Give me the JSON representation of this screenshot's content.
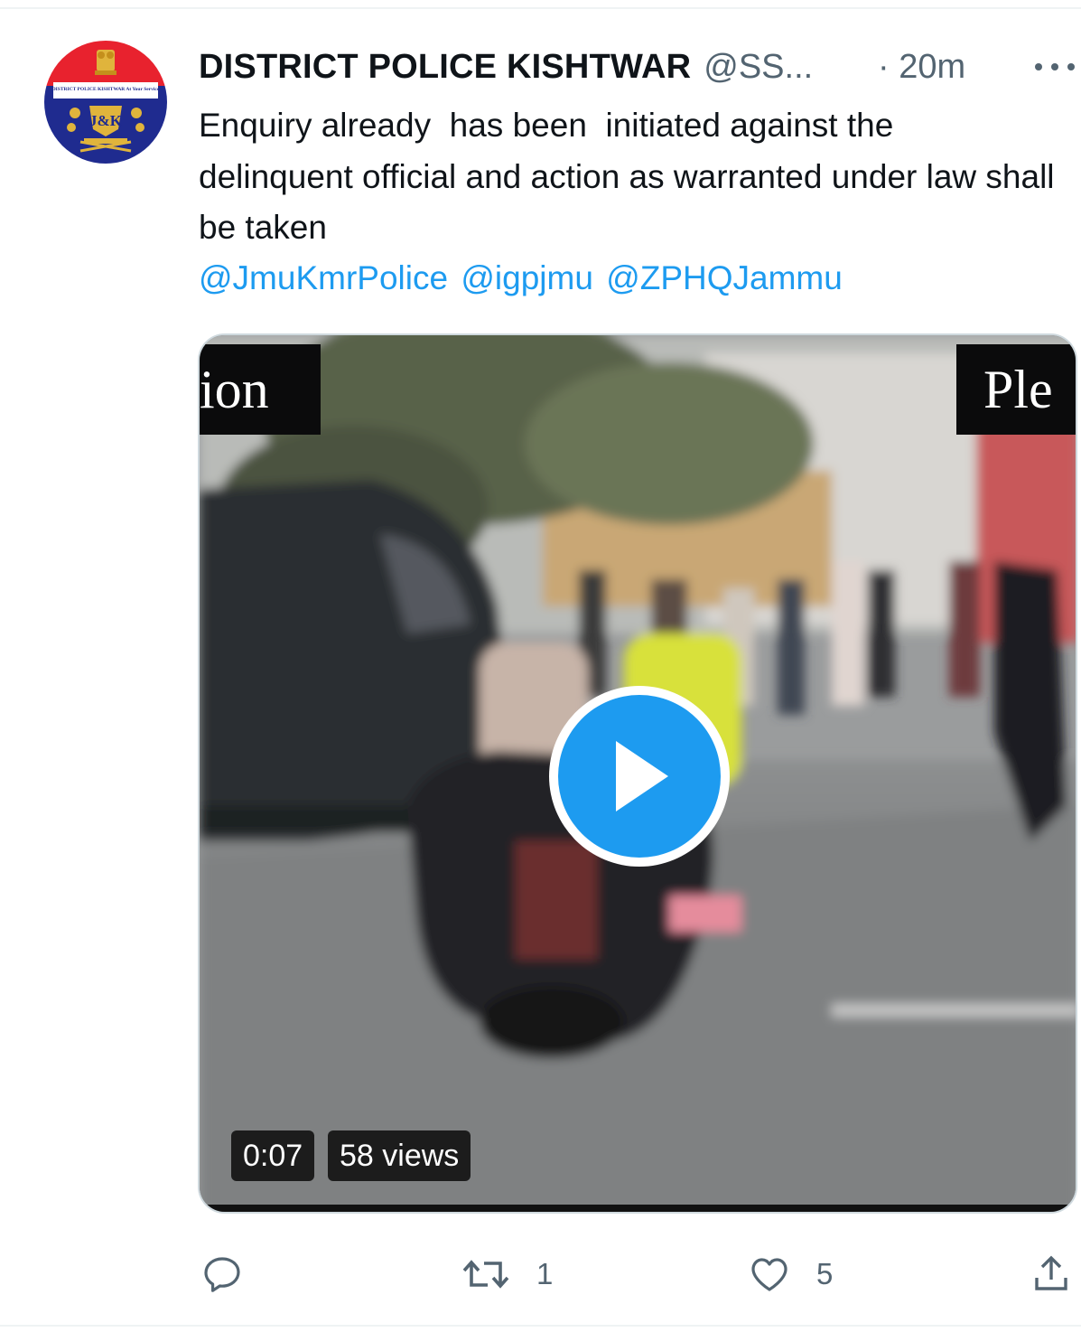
{
  "tweet": {
    "author": {
      "name": "DISTRICT POLICE KISHTWAR",
      "handle": "@SS...",
      "avatar_icon": "jk-police-emblem-icon",
      "avatar_text": "DISTRICT POLICE KISHTWAR At Your Service"
    },
    "time": "· 20m",
    "more_icon": "more-dots-icon",
    "text": "Enquiry already  has been  initiated against the delinquent official and action as warranted under law shall be taken",
    "mentions": [
      "@JmuKmrPolice",
      "@igpjmu",
      "@ZPHQJammu"
    ],
    "media": {
      "type": "video",
      "overlay_left_text": "ion",
      "overlay_right_text": "Ple",
      "duration": "0:07",
      "views": "58 views",
      "play_icon": "play-icon"
    },
    "actions": {
      "reply": {
        "icon": "reply-icon",
        "count": ""
      },
      "retweet": {
        "icon": "retweet-icon",
        "count": "1"
      },
      "like": {
        "icon": "heart-icon",
        "count": "5"
      },
      "share": {
        "icon": "share-icon",
        "count": ""
      }
    }
  },
  "colors": {
    "accent": "#1d9bf0",
    "text": "#0f1419",
    "secondary": "#536471",
    "border": "#cfd9de"
  }
}
